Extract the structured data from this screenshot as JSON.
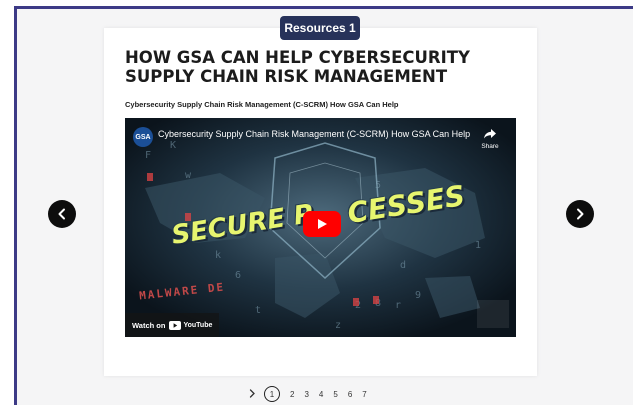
{
  "badge": {
    "label": "Resources 1"
  },
  "card": {
    "title": "HOW GSA CAN HELP CYBERSECURITY SUPPLY CHAIN RISK MANAGEMENT",
    "subtitle": "Cybersecurity Supply Chain Risk Management (C-SCRM) How GSA Can Help"
  },
  "video": {
    "channel_logo_text": "GSA",
    "title": "Cybersecurity Supply Chain Risk Management (C-SCRM) How GSA Can Help",
    "share_label": "Share",
    "watch_label": "Watch on",
    "youtube_label": "YouTube",
    "overlay_text_1": "SECURE P",
    "overlay_text_2": "CESSES",
    "overlay_text_3": "MALWARE DE"
  },
  "pager": {
    "pages": [
      "1",
      "2",
      "3",
      "4",
      "5",
      "6",
      "7"
    ],
    "current": "1"
  },
  "colors": {
    "frame_border": "#3c3a86",
    "badge_bg": "#27325a",
    "nav_button_bg": "#0d0d0d",
    "play_button": "#ff0000",
    "overlay_text": "#e7f56f"
  }
}
